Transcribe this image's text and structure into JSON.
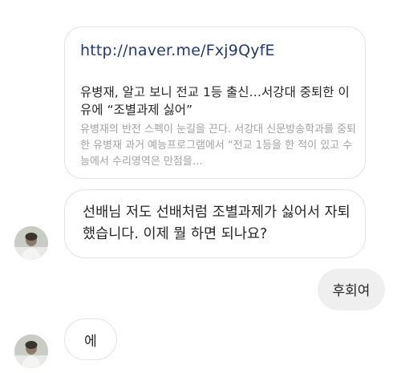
{
  "link_card": {
    "url": "http://naver.me/Fxj9QyfE",
    "title": "유병재, 알고 보니 전교 1등 출신…서강대 중퇴한 이유에 “조별과제 싫어”",
    "description": "유병재의 반전 스펙이 눈길을 끈다. 서강대 신문방송학과를 중퇴한 유병재 과거 예능프로그램에서 “전교 1등을 한 적이 있고 수능에서 수리영역은 만점을…"
  },
  "messages": [
    {
      "text": "선배님 저도 선배처럼 조별과제가 싫어서 자퇴했습니다. 이제 뭘 하면 되나요?"
    },
    {
      "text": "후회여"
    },
    {
      "text": "에"
    }
  ],
  "colors": {
    "outgoing_bubble": "#efefef",
    "incoming_border": "#e3e3e3",
    "link_url": "#233a6c",
    "muted_text": "#a2a2a2"
  },
  "icons": {
    "avatar": "profile-photo"
  }
}
